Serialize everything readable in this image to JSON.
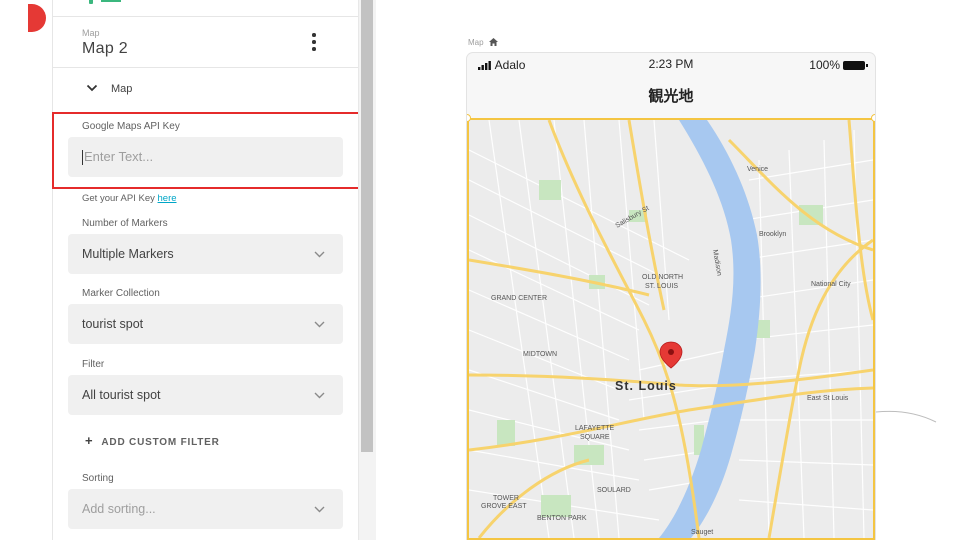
{
  "panel": {
    "component_type": "Map",
    "component_name": "Map 2",
    "section": {
      "label": "Map",
      "icon": "chevron-down-icon"
    },
    "api_key": {
      "label": "Google Maps API Key",
      "placeholder": "Enter Text...",
      "help_prefix": "Get your API Key ",
      "help_link": "here"
    },
    "markers": {
      "label": "Number of Markers",
      "value": "Multiple Markers"
    },
    "collection": {
      "label": "Marker Collection",
      "value": "tourist spot"
    },
    "filter": {
      "label": "Filter",
      "value": "All tourist spot"
    },
    "add_filter": {
      "label": "ADD CUSTOM FILTER",
      "icon": "plus-icon"
    },
    "sorting": {
      "label": "Sorting",
      "placeholder": "Add sorting..."
    },
    "more_icon": "more-vertical-icon"
  },
  "canvas": {
    "screen_label": "Map",
    "screen_icon": "home-icon",
    "status": {
      "carrier": "Adalo",
      "time": "2:23 PM",
      "battery": "100%"
    },
    "nav_title": "観光地",
    "map_labels": {
      "st_louis": "St. Louis",
      "old_north": "OLD NORTH",
      "old_north_2": "ST. LOUIS",
      "grand_center": "GRAND CENTER",
      "midtown": "MIDTOWN",
      "lafayette": "LAFAYETTE",
      "lafayette_2": "SQUARE",
      "soulard": "SOULARD",
      "tower_grove": "TOWER",
      "tower_grove_2": "GROVE EAST",
      "benton_park": "BENTON PARK",
      "venice": "Venice",
      "brooklyn": "Brooklyn",
      "national_city": "National City",
      "east_st_louis": "East St Louis",
      "salisbury": "Salisbury St",
      "sauget": "Sauget",
      "madison": "Madison"
    },
    "marker_color": "#e53935",
    "accent": "#f4c542"
  }
}
